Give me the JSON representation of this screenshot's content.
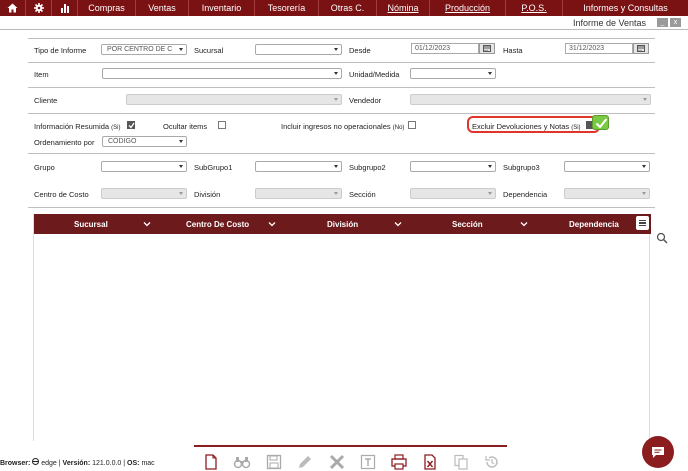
{
  "nav": {
    "items": [
      {
        "label": "Compras",
        "w": 58
      },
      {
        "label": "Ventas",
        "w": 53
      },
      {
        "label": "Inventario",
        "w": 66
      },
      {
        "label": "Tesorería",
        "w": 64
      },
      {
        "label": "Otras C.",
        "w": 58
      },
      {
        "label": "Nómina",
        "w": 53
      },
      {
        "label": "Producción",
        "w": 76
      },
      {
        "label": "P.O.S.",
        "w": 57
      }
    ],
    "last": "Informes y Consultas"
  },
  "window": {
    "title": "Informe de Ventas",
    "min": "_",
    "close": "x"
  },
  "form": {
    "tipo_label": "Tipo de Informe",
    "tipo_value": "POR CENTRO DE C",
    "sucursal_label": "Sucursal",
    "desde_label": "Desde",
    "desde_value": "01/12/2023",
    "hasta_label": "Hasta",
    "hasta_value": "31/12/2023",
    "item_label": "Item",
    "unidad_label": "Unidad/Medida",
    "cliente_label": "Cliente",
    "vendedor_label": "Vendedor",
    "info_resumida_label": "Información Resumida",
    "info_resumida_hint": "(Si)",
    "ocultar_label": "Ocultar items",
    "ingresos_label": "Incluir ingresos no operacionales",
    "ingresos_hint": "(No)",
    "excluir_label": "Excluir Devoluciones y Notas",
    "excluir_hint": "(Si)",
    "orden_label": "Ordenamiento por",
    "orden_value": "CÓDIGO",
    "grupo_label": "Grupo",
    "subgrupo1_label": "SubGrupo1",
    "subgrupo2_label": "Subgrupo2",
    "subgrupo3_label": "Subgrupo3",
    "centro_label": "Centro de Costo",
    "division_label": "División",
    "seccion_label": "Sección",
    "dependencia_label": "Dependencia"
  },
  "grid": {
    "columns": [
      "Sucursal",
      "Centro De Costo",
      "División",
      "Sección",
      "Dependencia"
    ]
  },
  "status": {
    "browser_label": "Browser:",
    "browser_value": "edge",
    "version_label": "Versión:",
    "version_value": "121.0.0.0",
    "os_label": "OS:",
    "os_value": "mac"
  },
  "colors": {
    "accent": "#7a1113",
    "highlight": "#e0352b",
    "check": "#7ac943"
  }
}
